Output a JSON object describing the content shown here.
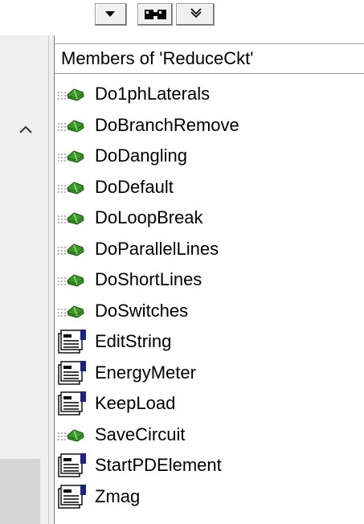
{
  "members_header": "Members of 'ReduceCkt'",
  "members": [
    {
      "label": "Do1phLaterals",
      "kind": "method"
    },
    {
      "label": "DoBranchRemove",
      "kind": "method"
    },
    {
      "label": "DoDangling",
      "kind": "method"
    },
    {
      "label": "DoDefault",
      "kind": "method"
    },
    {
      "label": "DoLoopBreak",
      "kind": "method"
    },
    {
      "label": "DoParallelLines",
      "kind": "method"
    },
    {
      "label": "DoShortLines",
      "kind": "method"
    },
    {
      "label": "DoSwitches",
      "kind": "method"
    },
    {
      "label": "EditString",
      "kind": "property"
    },
    {
      "label": "EnergyMeter",
      "kind": "property"
    },
    {
      "label": "KeepLoad",
      "kind": "property"
    },
    {
      "label": "SaveCircuit",
      "kind": "method"
    },
    {
      "label": "StartPDElement",
      "kind": "property"
    },
    {
      "label": "Zmag",
      "kind": "property"
    }
  ],
  "icons": {
    "method": "method-icon",
    "property": "property-icon",
    "scroll_up": "chevron-up-icon",
    "dropdown": "dropdown-arrow-icon",
    "find": "find-icon",
    "hide": "hide-icon"
  },
  "colors": {
    "method_green": "#3a9a2a",
    "property_blue": "#1a237e"
  }
}
